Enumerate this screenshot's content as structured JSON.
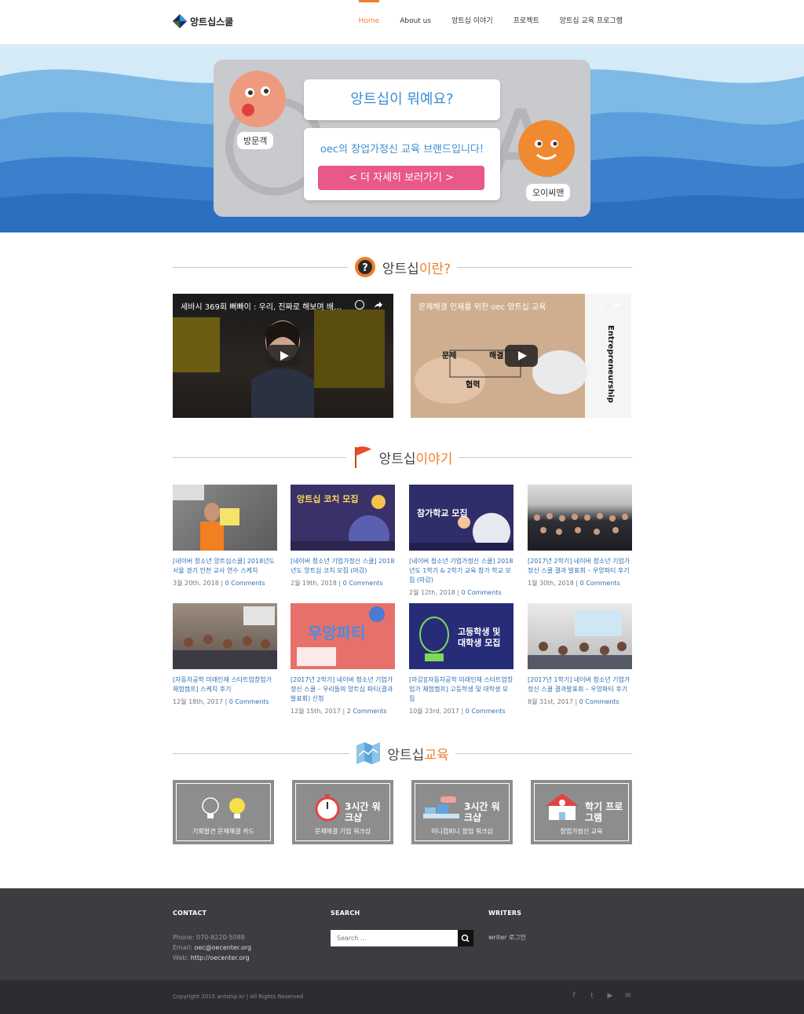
{
  "header": {
    "logo_text": "앙트십스쿨",
    "nav": [
      {
        "label": "Home",
        "active": true
      },
      {
        "label": "About us",
        "active": false
      },
      {
        "label": "앙트십 이야기",
        "active": false
      },
      {
        "label": "프로젝트",
        "active": false
      },
      {
        "label": "앙트십 교육 프로그램",
        "active": false
      }
    ]
  },
  "hero": {
    "question": "앙트십이 뭐예요?",
    "answer": "oec의 창업가정신 교육 브랜드입니다!",
    "more_button": "< 더 자세히 보러가기 >",
    "visitor_label": "방문객",
    "oec_label": "오이씨맨"
  },
  "sections": {
    "what": {
      "t1": "앙트십",
      "t2": "이란?"
    },
    "story": {
      "t1": "앙트십",
      "t2": "이야기"
    },
    "edu": {
      "t1": "앙트십",
      "t2": "교육"
    }
  },
  "videos": [
    {
      "title": "세바시 369회 뻐빠이 : 우리, 진짜로 해보며 배우..."
    },
    {
      "title": "문제해결 인재를 위한 oec 앙트십 교육",
      "side_text": "Entrepreneurship",
      "words": [
        "문제",
        "해결",
        "협력"
      ]
    }
  ],
  "posts": [
    {
      "title": "[네이버 청소년 앙트십스쿨] 2018년도 서울 경기 인천 교사 연수 스케치",
      "date": "3월 20th, 2018",
      "comments": "0 Comments"
    },
    {
      "title": "[네이버 청소년 기업가정신 스쿨] 2018년도 앙트십 코치 모집 (마감)",
      "date": "2월 19th, 2018",
      "comments": "0 Comments",
      "thumb_text": "앙트십 코치 모집"
    },
    {
      "title": "[네이버 청소년 기업가정신 스쿨] 2018년도 1학기 & 2학기 교육 참가 학교 모집 (마감)",
      "date": "2월 12th, 2018",
      "comments": "0 Comments",
      "thumb_text": "참가학교 모집"
    },
    {
      "title": "[2017년 2학기] 네이버 청소년 기업가정신 스쿨 결과 발표회 – 우앙파티 후기",
      "date": "1월 30th, 2018",
      "comments": "0 Comments"
    },
    {
      "title": "[자동차공학 미래인재 스타트업창업가 체험캠프] 스케치 후기",
      "date": "12월 18th, 2017",
      "comments": "0 Comments"
    },
    {
      "title": "[2017년 2학기] 네이버 청소년 기업가정신 스쿨 – 우리들의 앙트십 파티(결과발표회) 신청",
      "date": "12월 15th, 2017",
      "comments": "2 Comments",
      "thumb_text": "우앙파티"
    },
    {
      "title": "[마감][자동차공학 미래인재 스타트업창업가 체험캠프] 고등학생 및 대학생 모집",
      "date": "10월 23rd, 2017",
      "comments": "0 Comments",
      "thumb_text": "고등학생 및 대학생 모집"
    },
    {
      "title": "[2017년 1학기] 네이버 청소년 기업가정신 스쿨 결과발표회 – 우앙파티 후기",
      "date": "8월 31st, 2017",
      "comments": "0 Comments"
    }
  ],
  "edu": [
    {
      "big": "",
      "caption": "기회발견 문제해결 카드",
      "icon": "lightbulb-icon"
    },
    {
      "big": "3시간 워크샵",
      "caption": "문제해결 기업 워크샵",
      "icon": "stopwatch-icon"
    },
    {
      "big": "3시간 워크샵",
      "caption": "미니컴퍼니 창업 워크샵",
      "icon": "hands-icon"
    },
    {
      "big": "학기 프로그램",
      "caption": "창업가정신 교육",
      "icon": "school-icon"
    }
  ],
  "footer": {
    "contact_head": "CONTACT",
    "phone_label": "Phone:",
    "phone": "070-8220-5088",
    "email_label": "Email:",
    "email": "oec@oecenter.org",
    "web_label": "Web:",
    "web": "http://oecenter.org",
    "search_head": "SEARCH",
    "search_placeholder": "Search ...",
    "writers_head": "WRITERS",
    "writer_login": "writer 로그인",
    "copyright": "Copyright 2015 antship.kr | All Rights Reserved"
  },
  "colors": {
    "accent": "#f27d2a",
    "link": "#2e6fb3",
    "pink_button": "#e8588a",
    "footer": "#3c3d40"
  }
}
